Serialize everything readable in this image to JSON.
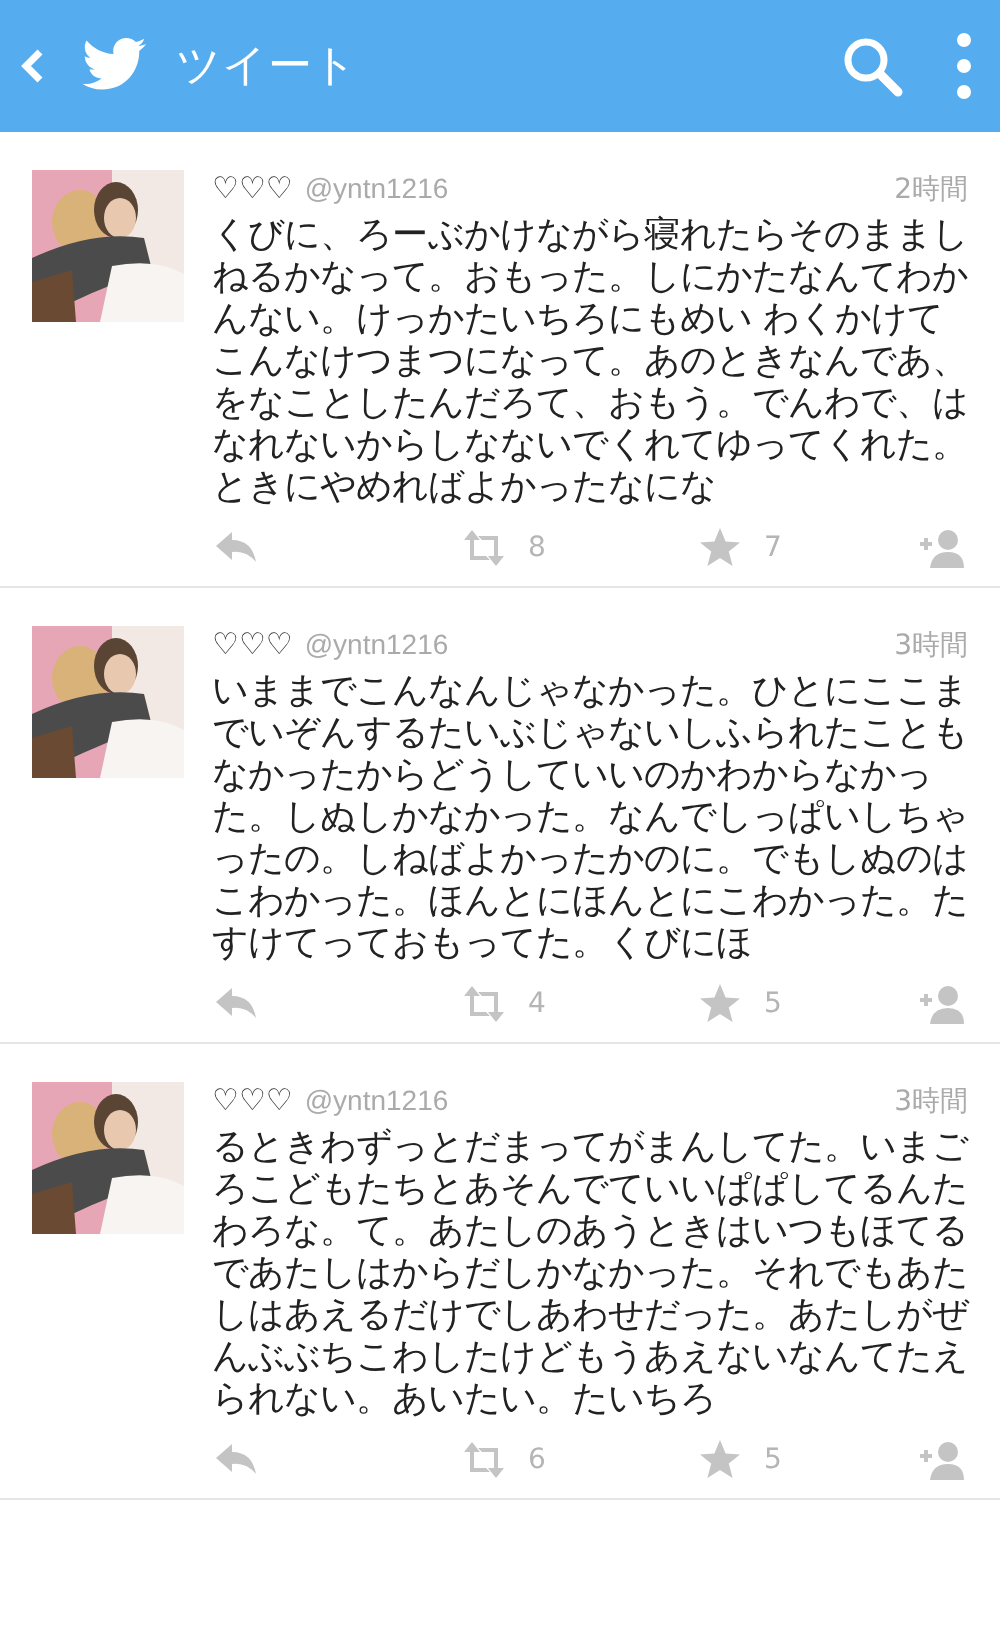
{
  "app_bar": {
    "title": "ツイート"
  },
  "tweets": [
    {
      "name": "♡♡♡",
      "handle": "@yntn1216",
      "time": "2時間",
      "text": "くびに、ろーぶかけながら寝れたらそのまましねるかなって。おもった。しにかたなんてわかんない。けっかたいちろにもめい わくかけてこんなけつまつになって。あのときなんであ、をなことしたんだろて、おもう。でんわで、はなれないからしなないでくれてゆってくれた。ときにやめればよかったなにな",
      "retweets": "8",
      "favorites": "7"
    },
    {
      "name": "♡♡♡",
      "handle": "@yntn1216",
      "time": "3時間",
      "text": "いままでこんなんじゃなかった。ひとにここまでいぞんするたいぶじゃないしふられたこともなかったからどうしていいのかわからなかった。しぬしかなかった。なんでしっぱいしちゃったの。しねばよかったかのに。でもしぬのはこわかった。ほんとにほんとにこわかった。たすけてっておもってた。くびにほ",
      "retweets": "4",
      "favorites": "5"
    },
    {
      "name": "♡♡♡",
      "handle": "@yntn1216",
      "time": "3時間",
      "text": "るときわずっとだまってがまんしてた。いまごろこどもたちとあそんでていいぱぱしてるんたわろな。て。あたしのあうときはいつもほてるであたしはからだしかなかった。それでもあたしはあえるだけでしあわせだった。あたしがぜんぶぶちこわしたけどもうあえないなんてたえられない。あいたい。たいちろ",
      "retweets": "6",
      "favorites": "5"
    }
  ]
}
